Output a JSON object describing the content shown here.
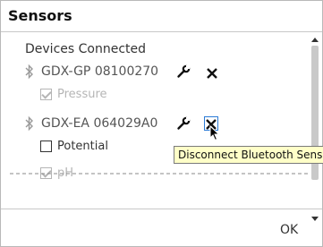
{
  "dialog": {
    "title": "Sensors",
    "ok_label": "OK"
  },
  "devices_heading": "Devices Connected",
  "devices": [
    {
      "name": "GDX-GP 08100270",
      "sensors": [
        {
          "label": "Pressure",
          "checked": true,
          "enabled": false
        }
      ]
    },
    {
      "name": "GDX-EA 064029A0",
      "sensors": [
        {
          "label": "Potential",
          "checked": false,
          "enabled": true
        },
        {
          "label": "pH",
          "checked": true,
          "enabled": false
        }
      ]
    }
  ],
  "tooltip": "Disconnect Bluetooth Sensor",
  "icons": {
    "bluetooth": "bluetooth-icon",
    "configure": "wrench-icon",
    "disconnect": "close-icon"
  }
}
